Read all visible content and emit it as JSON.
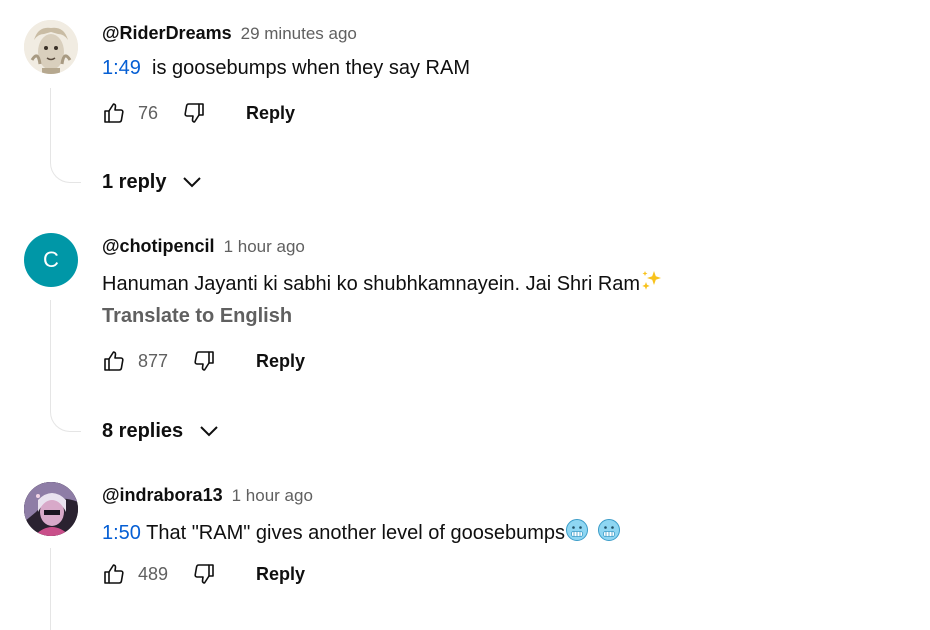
{
  "comments": [
    {
      "author": "@RiderDreams",
      "time": "29 minutes ago",
      "timestamp_link": "1:49",
      "text": "  is goosebumps when they say RAM",
      "likes": "76",
      "reply_label": "Reply",
      "replies_label": "1 reply"
    },
    {
      "author": "@chotipencil",
      "avatar_letter": "C",
      "avatar_color": "#0097a7",
      "time": "1 hour ago",
      "text": "Hanuman Jayanti ki sabhi ko shubhkamnayein. Jai Shri Ram",
      "translate_label": "Translate to English",
      "likes": "877",
      "reply_label": "Reply",
      "replies_label": "8 replies"
    },
    {
      "author": "@indrabora13",
      "time": "1 hour ago",
      "timestamp_link": "1:50",
      "text": " That \"RAM\" gives another level of goosebumps",
      "likes": "489",
      "reply_label": "Reply"
    }
  ],
  "icons": {
    "like": "thumbs-up-icon",
    "dislike": "thumbs-down-icon",
    "expand": "chevron-down-icon",
    "sparkles": "sparkles-emoji",
    "cold_face": "cold-face-emoji"
  },
  "colors": {
    "link": "#065fd4",
    "secondary_text": "#606060",
    "avatar_c": "#0097a7"
  }
}
